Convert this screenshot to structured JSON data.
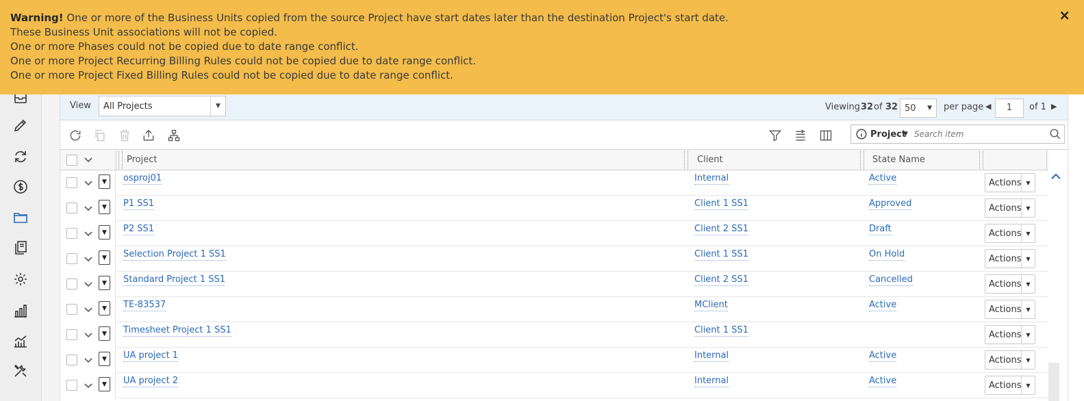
{
  "warning": {
    "title": "Warning!",
    "lines": [
      "One or more of the Business Units copied from the source Project have start dates later than the destination Project's start date.",
      "These Business Unit associations will not be copied.",
      "One or more Phases could not be copied due to date range conflict.",
      "One or more Project Recurring Billing Rules could not be copied due to date range conflict.",
      "One or more Project Fixed Billing Rules could not be copied due to date range conflict."
    ],
    "close_label": "×"
  },
  "rail": {
    "icons": [
      "inbox-icon",
      "pencil-icon",
      "refresh-cycle-icon",
      "dollar-icon",
      "folder-icon",
      "documents-icon",
      "gear-icon",
      "bar-chart-icon",
      "analytics-icon",
      "tools-icon"
    ]
  },
  "viewbar": {
    "view_label": "View",
    "view_value": "All Projects",
    "viewing_label": "Viewing",
    "viewing_count": "32",
    "of_label": "of",
    "viewing_total": "32",
    "page_size": "50",
    "per_page_label": "per page",
    "page_number": "1",
    "of_pages": "of 1"
  },
  "toolbar": {
    "search_scope": "Project",
    "search_placeholder": "Search item"
  },
  "grid": {
    "columns": [
      "Project",
      "Client",
      "State Name"
    ],
    "rows": [
      {
        "project": "osproj01",
        "client": "Internal",
        "state": "Active",
        "action": "Actions"
      },
      {
        "project": "P1 SS1",
        "client": "Client 1 SS1",
        "state": "Approved",
        "action": "Actions"
      },
      {
        "project": "P2 SS1",
        "client": "Client 2 SS1",
        "state": "Draft",
        "action": "Actions"
      },
      {
        "project": "Selection Project 1 SS1",
        "client": "Client 1 SS1",
        "state": "On Hold",
        "action": "Actions"
      },
      {
        "project": "Standard Project 1 SS1",
        "client": "Client 2 SS1",
        "state": "Cancelled",
        "action": "Actions"
      },
      {
        "project": "TE-83537",
        "client": "MClient",
        "state": "Active",
        "action": "Actions"
      },
      {
        "project": "Timesheet Project 1 SS1",
        "client": "Client 1 SS1",
        "state": "",
        "action": "Actions"
      },
      {
        "project": "UA project 1",
        "client": "Internal",
        "state": "Active",
        "action": "Actions"
      },
      {
        "project": "UA project 2",
        "client": "Internal",
        "state": "Active",
        "action": "Actions"
      }
    ]
  },
  "colors": {
    "warning_bg": "#f3bc4b",
    "link": "#2a6ab8",
    "view_bar_bg": "#eaf2fa",
    "rail_bg": "#eeeeee"
  }
}
